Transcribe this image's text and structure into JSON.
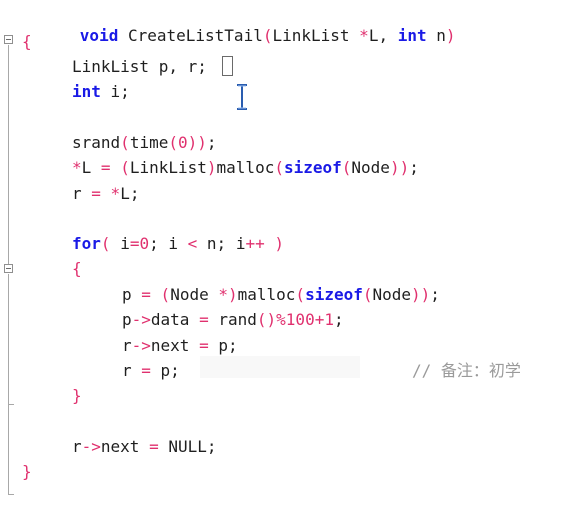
{
  "editor": {
    "lines": [
      {
        "id": "l1",
        "text": "void CreateListTail(LinkList *L, int n)"
      },
      {
        "id": "l2",
        "text": "{"
      },
      {
        "id": "l3",
        "text": "LinkList p, r;"
      },
      {
        "id": "l4",
        "text": "int i;"
      },
      {
        "id": "l5",
        "text": "srand(time(0));"
      },
      {
        "id": "l6",
        "text": "*L = (LinkList)malloc(sizeof(Node));"
      },
      {
        "id": "l7",
        "text": "r = *L;"
      },
      {
        "id": "l8",
        "text": "for( i=0; i < n; i++ )"
      },
      {
        "id": "l9",
        "text": "{"
      },
      {
        "id": "l10",
        "text": "p = (Node *)malloc(sizeof(Node));"
      },
      {
        "id": "l11",
        "text": "p->data = rand()%100+1;"
      },
      {
        "id": "l12",
        "text": "r->next = p;"
      },
      {
        "id": "l13",
        "text": "r = p;"
      },
      {
        "id": "l14",
        "text": "}"
      },
      {
        "id": "l15",
        "text": "r->next = NULL;"
      },
      {
        "id": "l16",
        "text": "}"
      }
    ],
    "comment": "// 备注：初学"
  },
  "colors": {
    "keyword": "#1a1ae6",
    "operator": "#e0306e",
    "text": "#1f1f1f",
    "comment": "#9a9a9a"
  }
}
